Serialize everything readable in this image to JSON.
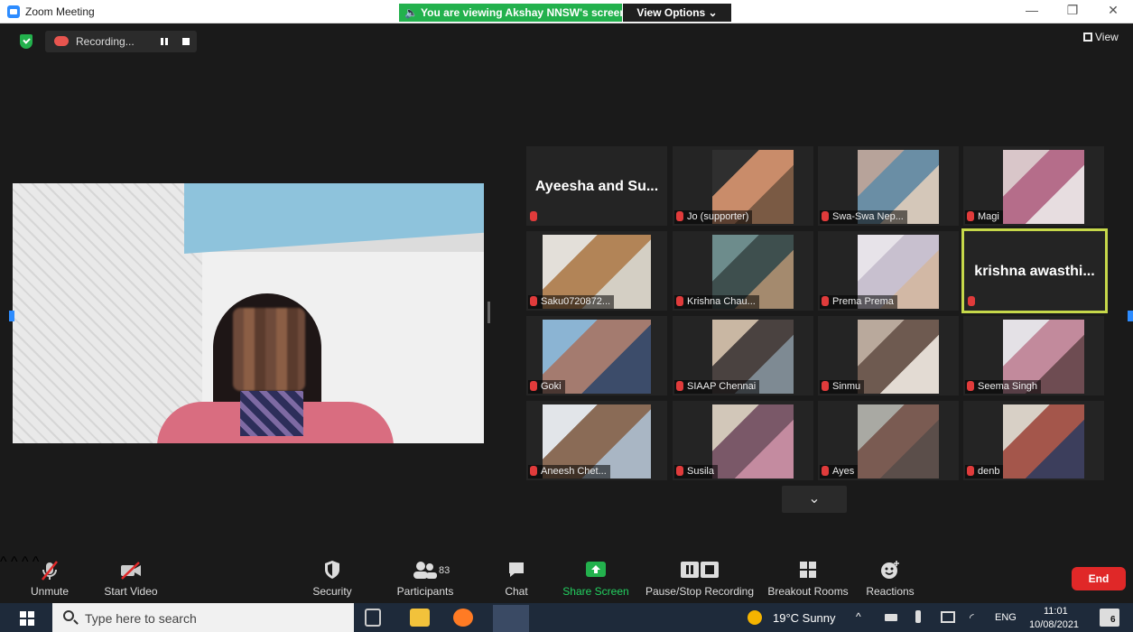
{
  "window": {
    "title": "Zoom Meeting",
    "viewing_banner": "🔈 You are viewing Akshay NNSW's screen",
    "view_options": "View Options ⌄",
    "minimize": "—",
    "maximize": "❐",
    "close": "✕"
  },
  "meeting_bar": {
    "recording_label": "Recording...",
    "view_label": "View"
  },
  "gallery": [
    {
      "name": "Ayeesha and Su...",
      "label": "",
      "type": "text"
    },
    {
      "name": "",
      "label": "Jo (supporter)",
      "type": "video",
      "colors": [
        "#2f2f2f",
        "#c98c6a",
        "#7a5a44"
      ]
    },
    {
      "name": "",
      "label": "Swa-Swa Nep...",
      "type": "video",
      "colors": [
        "#b7a39a",
        "#6a8ea5",
        "#d4c7b9"
      ]
    },
    {
      "name": "",
      "label": "Magi",
      "type": "video",
      "colors": [
        "#d9c6c9",
        "#b56d8a",
        "#e7dde0"
      ]
    },
    {
      "name": "",
      "label": "Saku0720872...",
      "type": "video",
      "colors": [
        "#e3dfd9",
        "#b28457",
        "#d4cfc4"
      ]
    },
    {
      "name": "",
      "label": "Krishna Chau...",
      "type": "video",
      "colors": [
        "#6d8c8c",
        "#3e4f4e",
        "#a48a6e"
      ]
    },
    {
      "name": "",
      "label": "Prema Prema",
      "type": "video",
      "colors": [
        "#e7e3e9",
        "#c8c0cf",
        "#d2b8a5"
      ]
    },
    {
      "name": "krishna awasthi...",
      "label": "",
      "type": "text",
      "active": true
    },
    {
      "name": "",
      "label": "Goki",
      "type": "video",
      "colors": [
        "#8bb4d3",
        "#a47b6f",
        "#3c4c6a"
      ]
    },
    {
      "name": "",
      "label": "SIAAP Chennai",
      "type": "video",
      "colors": [
        "#c9b7a3",
        "#4a4240",
        "#7e8a93"
      ]
    },
    {
      "name": "",
      "label": "Sinmu",
      "type": "video",
      "colors": [
        "#b9a99c",
        "#6e5a50",
        "#e3dbd3"
      ]
    },
    {
      "name": "",
      "label": "Seema Singh",
      "type": "video",
      "colors": [
        "#e4e1e6",
        "#c28a9c",
        "#6e4c52"
      ]
    },
    {
      "name": "",
      "label": "Aneesh Chet...",
      "type": "video",
      "colors": [
        "#e2e5e9",
        "#8a6b56",
        "#a9b6c4"
      ]
    },
    {
      "name": "",
      "label": "Susila",
      "type": "video",
      "colors": [
        "#d2c7b9",
        "#7a5868",
        "#c48ba0"
      ]
    },
    {
      "name": "",
      "label": "Ayes",
      "type": "video",
      "colors": [
        "#a9a9a3",
        "#7a5b52",
        "#5b4e4a"
      ]
    },
    {
      "name": "",
      "label": "denb",
      "type": "video",
      "colors": [
        "#d8d0c6",
        "#a4564b",
        "#3c3e5c"
      ]
    }
  ],
  "more_chevron": "⌄",
  "toolbar": {
    "unmute": "Unmute",
    "start_video": "Start Video",
    "security": "Security",
    "participants": "Participants",
    "participants_count": "83",
    "chat": "Chat",
    "share_screen": "Share Screen",
    "pause_recording": "Pause/Stop Recording",
    "breakout_rooms": "Breakout Rooms",
    "reactions": "Reactions",
    "end": "End",
    "caret": "^"
  },
  "taskbar": {
    "search_placeholder": "Type here to search",
    "weather": "19°C  Sunny",
    "language": "ENG",
    "time": "11:01",
    "date": "10/08/2021",
    "notification_count": "6"
  },
  "colors": {
    "share_green": "#23b14d",
    "end_red": "#e02828",
    "active_speaker": "#c6d84a",
    "zoom_blue": "#2d8cff"
  }
}
